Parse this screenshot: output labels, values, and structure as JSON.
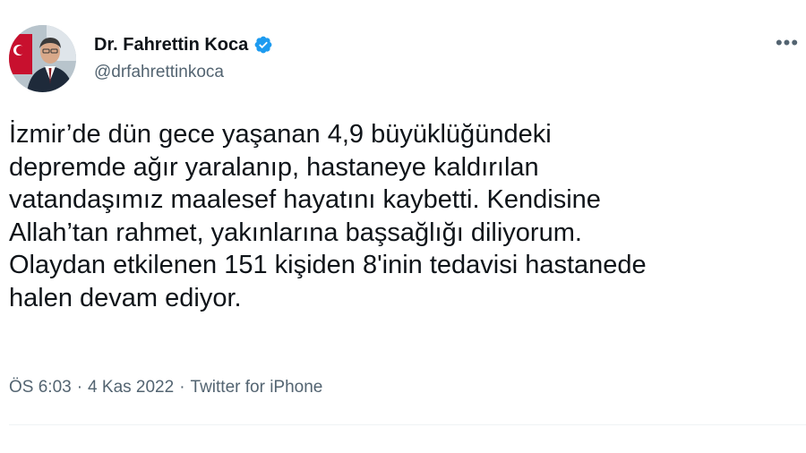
{
  "author": {
    "display_name": "Dr. Fahrettin Koca",
    "handle": "@drfahrettinkoca",
    "verified_icon": "verified-badge-icon",
    "avatar_icon": "profile-photo"
  },
  "tweet": {
    "text": "İzmir’de dün gece yaşanan 4,9 büyüklüğündeki\ndepremde ağır yaralanıp, hastaneye kaldırılan\nvatandaşımız maalesef hayatını kaybetti. Kendisine\nAllah’tan rahmet, yakınlarına başsağlığı diliyorum.\nOlaydan etkilenen 151 kişiden 8'inin tedavisi hastanede\nhalen devam ediyor.",
    "time": "ÖS 6:03",
    "date": "4 Kas 2022",
    "source": "Twitter for iPhone",
    "separator": "·"
  },
  "menu": {
    "more_icon": "more-options-icon",
    "more_label": "•••"
  },
  "colors": {
    "text": "#0f1419",
    "secondary": "#536471",
    "verified": "#1d9bf0",
    "divider": "#eff3f4"
  }
}
